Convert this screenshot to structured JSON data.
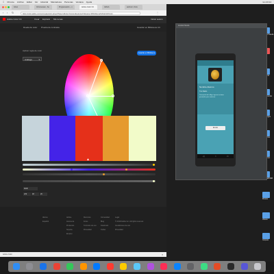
{
  "menubar": {
    "items": [
      "Chrome",
      "Archivo",
      "Editar",
      "Ver",
      "Historial",
      "Marcadores",
      "Personas",
      "Ventana",
      "Ayuda"
    ],
    "right": "lun 23:14"
  },
  "browser": {
    "tabs": [
      "Inbox",
      "Chromecast - Su",
      "Programación – x",
      "Adobe Color CC",
      "Github",
      "android - Dots"
    ],
    "active_tab": 3,
    "url": "https://color.adobe.com/es/create/color-wheel/?base=2&rule=Custom&selected=3&name=Mi%20tema%20de%20Color"
  },
  "site": {
    "brand": "Adobe Color CC",
    "nav": [
      "Crear",
      "Explorar",
      "Mis temas"
    ],
    "user": "Iniciar sesión",
    "subnav": [
      "Rueda de color",
      "Prueba de contraste",
      "Guardar en Biblioteca CC"
    ],
    "rule_label": "Aplicar regla de color",
    "rule_value": "Análogo",
    "primary_button": "Guardar en Biblioteca",
    "footer_cols": [
      {
        "title": "Idioma",
        "items": [
          "Español"
        ]
      },
      {
        "title": "Adobe",
        "items": [
          "Acerca de",
          "Productos",
          "Soporte",
          "Empleo"
        ]
      },
      {
        "title": "Recursos",
        "items": [
          "Foros",
          "Términos de uso",
          "Privacidad"
        ]
      },
      {
        "title": "Comunidad",
        "items": [
          "Blog",
          "Facebook",
          "Twitter"
        ]
      },
      {
        "title": "Legal",
        "items": [
          "© 2018 Adobe Inc. All rights reserved.",
          "Condiciones de uso",
          "Privacidad"
        ]
      }
    ]
  },
  "colors": {
    "swatches": [
      "#c6d4db",
      "#4423e8",
      "#e5301a",
      "#e59a2f",
      "#f2fbc9"
    ],
    "sliders": [
      "#888888",
      "#8a2be2",
      "#e5301a",
      "#e59a2f",
      "#dddddd"
    ]
  },
  "values": {
    "mode": "RGB",
    "r": "229",
    "g": "48",
    "b": "26"
  },
  "studio": {
    "app_title": "Android Studio",
    "app_name": "Nombre Alumno",
    "subtitle": "Tus Datos",
    "body": "Descripción de la App: ingresa tus datos personales para continuar.",
    "button": "Enviar"
  },
  "desktop": {
    "labels": [
      "Android Studio",
      "Color",
      "Capturas",
      "Documentos",
      "Descargas",
      "Proyectos",
      "Imágenes",
      "APPSERVER",
      "Música",
      "Videos",
      "Carpeta"
    ]
  },
  "footer_badge": "Adobe Color"
}
